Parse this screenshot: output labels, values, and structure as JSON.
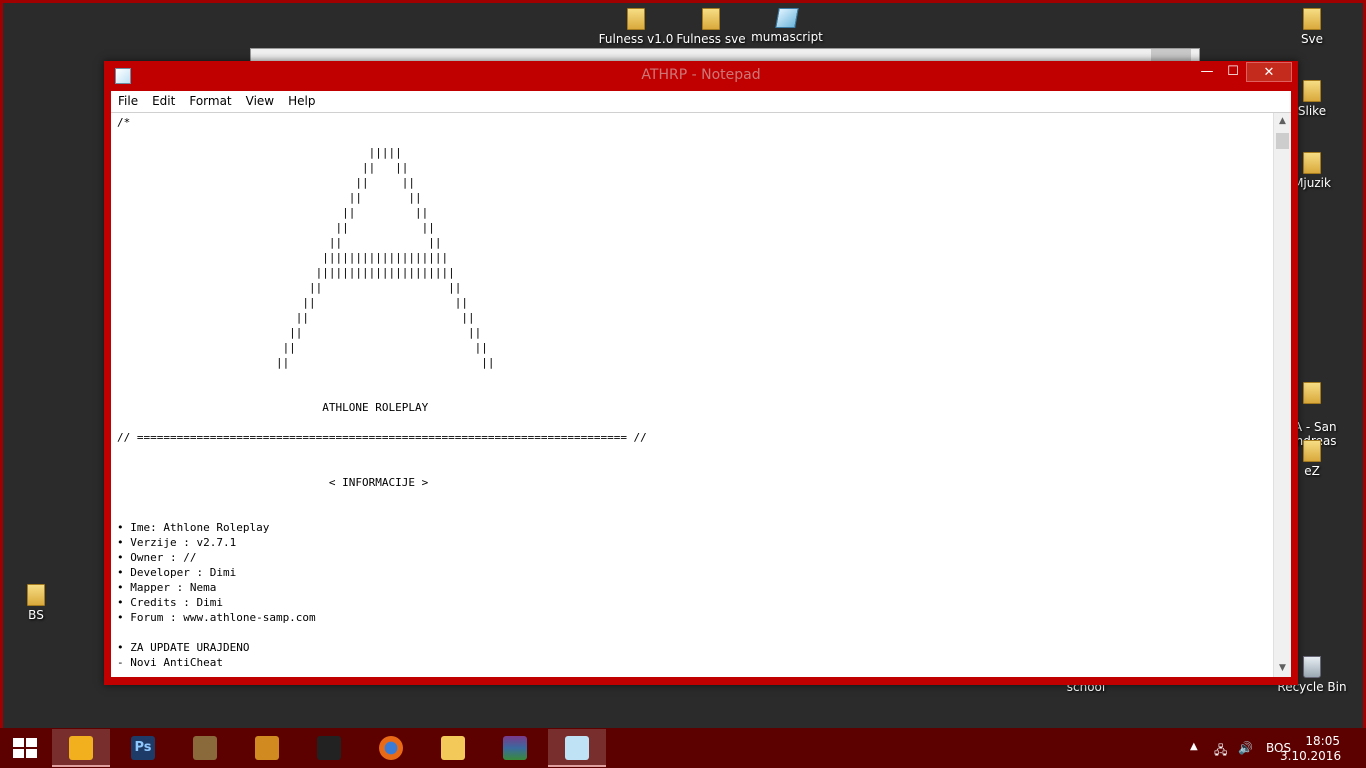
{
  "desktop": {
    "icons": [
      {
        "label": "Fulness v1.0",
        "kind": "folder"
      },
      {
        "label": "Fulness sve",
        "kind": "folder"
      },
      {
        "label": "mumascript",
        "kind": "script"
      },
      {
        "label": "Sve",
        "kind": "folder"
      },
      {
        "label": "Slike",
        "kind": "folder"
      },
      {
        "label": "Mjuzik",
        "kind": "folder"
      },
      {
        "label": "TA - San\nAndreas",
        "kind": "folder"
      },
      {
        "label": "eZ",
        "kind": "folder"
      },
      {
        "label": "BS",
        "kind": "folder"
      },
      {
        "label": "school",
        "kind": "folder"
      },
      {
        "label": "Recycle Bin",
        "kind": "recycle-bin"
      }
    ]
  },
  "window": {
    "title": "ATHRP - Notepad",
    "controls": {
      "minimize": "—",
      "maximize": "☐",
      "close": "✕"
    },
    "menu": [
      "File",
      "Edit",
      "Format",
      "View",
      "Help"
    ]
  },
  "editor": {
    "content": "/*\n\n                                      |||||\n                                     ||   ||\n                                    ||     ||\n                                   ||       ||\n                                  ||         ||\n                                 ||           ||\n                                ||             ||\n                               |||||||||||||||||||\n                              |||||||||||||||||||||\n                             ||                   ||\n                            ||                     ||\n                           ||                       ||\n                          ||                         ||\n                         ||                           ||\n                        ||                             ||\n\n\n                               ATHLONE ROLEPLAY\n\n// ========================================================================== //\n\n\n                                < INFORMACIJE >\n\n\n• Ime: Athlone Roleplay\n• Verzije : v2.7.1\n• Owner : //\n• Developer : Dimi\n• Mapper : Nema\n• Credits : Dimi\n• Forum : www.athlone-samp.com\n\n• ZA UPDATE URAJDENO\n- Novi AntiCheat\n- Novi COS Sistem"
  },
  "taskbar": {
    "apps": [
      {
        "name": "winamp",
        "color": "#f2b01e",
        "active": true
      },
      {
        "name": "photoshop",
        "color": "#1e3a66",
        "label": "Ps"
      },
      {
        "name": "gta-san-andreas",
        "color": "#8a6a3a"
      },
      {
        "name": "mafia",
        "color": "#d08a20"
      },
      {
        "name": "counter-strike",
        "color": "#222222"
      },
      {
        "name": "firefox",
        "color": "#e86a17"
      },
      {
        "name": "file-explorer",
        "color": "#f3c95a"
      },
      {
        "name": "winrar",
        "color": "#7a3a8a"
      },
      {
        "name": "notepad",
        "color": "#bfe2f5",
        "active": true
      }
    ],
    "tray": {
      "language": "BOS",
      "time": "18:05",
      "date": "3.10.2016"
    }
  }
}
